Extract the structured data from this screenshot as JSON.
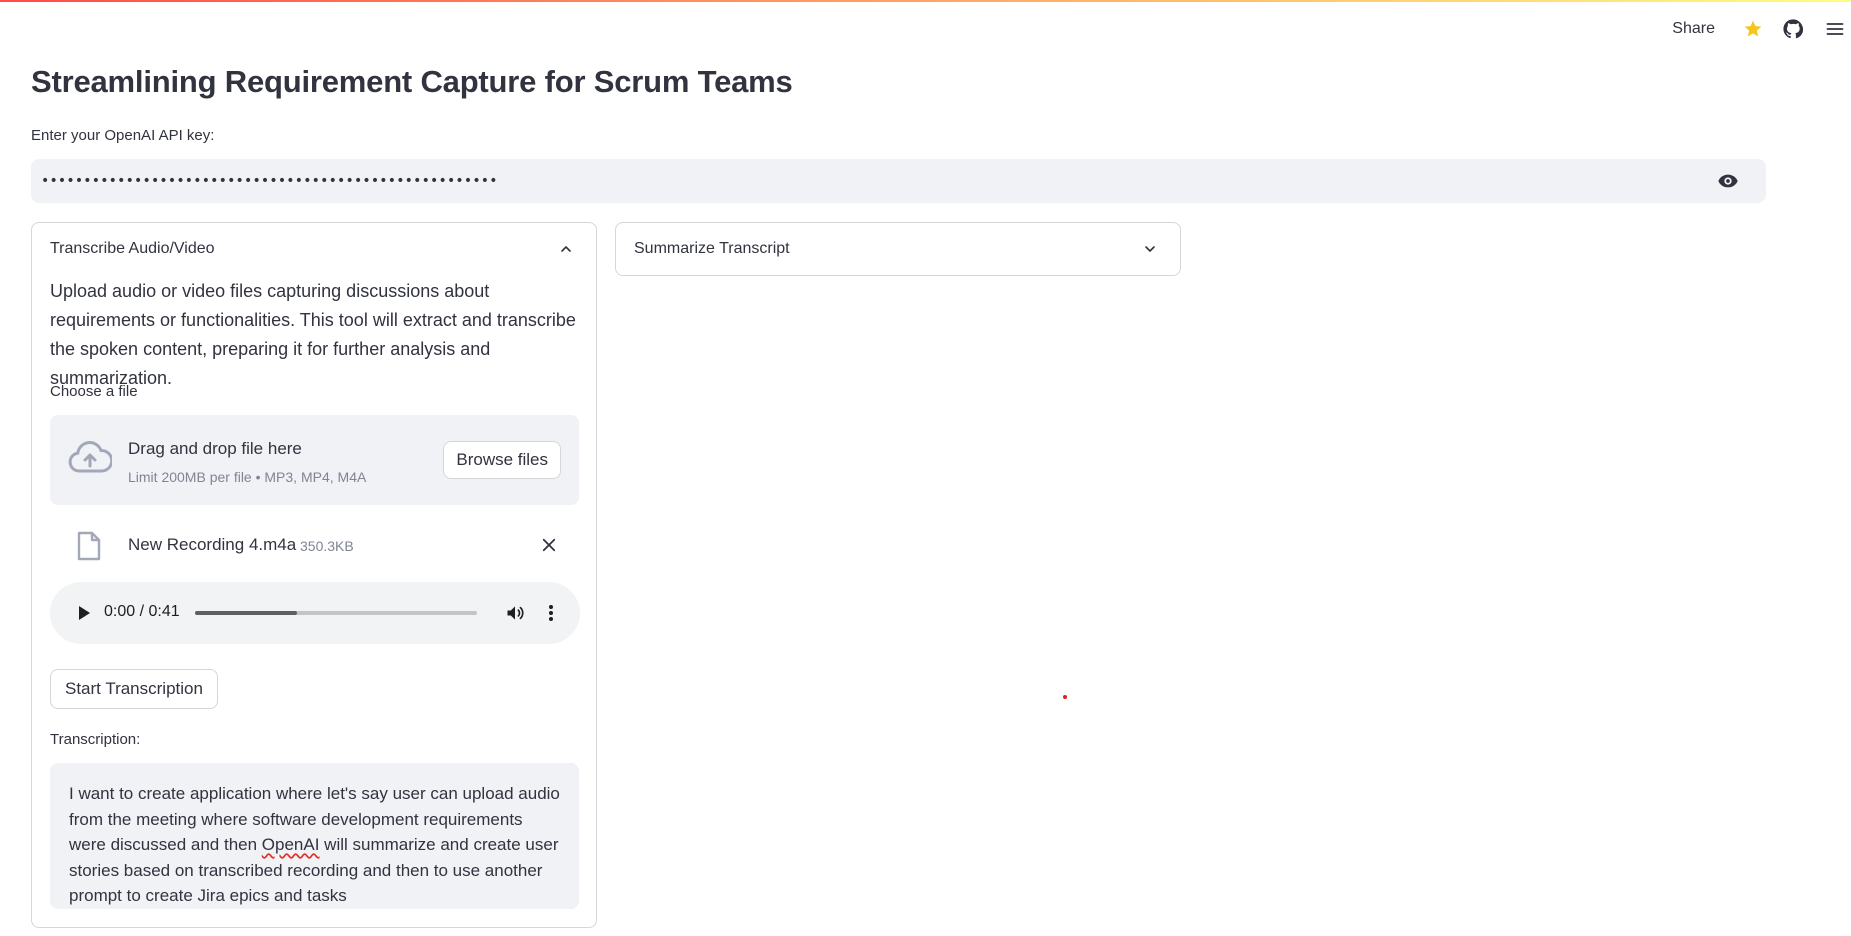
{
  "header": {
    "share_label": "Share",
    "icons": [
      "star-icon",
      "github-icon",
      "hamburger-menu-icon"
    ],
    "accent_colors": [
      "#ff4b4b",
      "#fffd80"
    ]
  },
  "page": {
    "title": "Streamlining Requirement Capture for Scrum Teams"
  },
  "api_key": {
    "label": "Enter your OpenAI API key:",
    "masked_value": "••••••••••••••••••••••••••••••••••••••••••••••••••••••"
  },
  "transcribe_panel": {
    "header": "Transcribe Audio/Video",
    "expanded": true,
    "description": "Upload audio or video files capturing discussions about requirements or functionalities. This tool will extract and transcribe the spoken content, preparing it for further analysis and summarization.",
    "uploader": {
      "label": "Choose a file",
      "drop_text": "Drag and drop file here",
      "limit_text": "Limit 200MB per file • MP3, MP4, M4A",
      "browse_label": "Browse files"
    },
    "uploaded_file": {
      "name": "New Recording 4.m4a",
      "size": "350.3KB"
    },
    "audio_player": {
      "time": "0:00 / 0:41",
      "progress_fraction": 0.36
    },
    "start_button": "Start Transcription",
    "transcription_label": "Transcription:",
    "transcription_before": "I want to create application where let's say user can upload audio from the meeting where software development requirements were discussed and then ",
    "transcription_misspelled": "OpenAI",
    "transcription_after": " will summarize and create user stories based on transcribed recording and then to use another prompt to create Jira epics and tasks"
  },
  "summarize_panel": {
    "header": "Summarize Transcript",
    "expanded": false
  }
}
